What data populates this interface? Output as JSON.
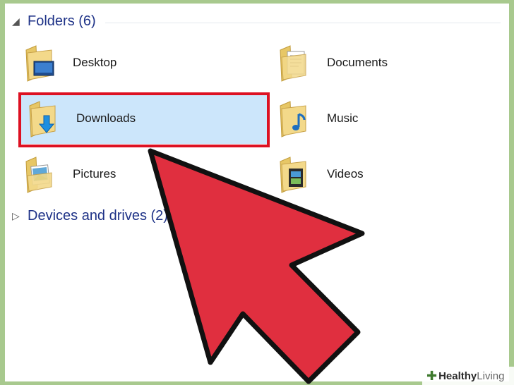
{
  "folders_group": {
    "label": "Folders (6)"
  },
  "folders": [
    {
      "label": "Desktop",
      "icon": "desktop-folder-icon"
    },
    {
      "label": "Documents",
      "icon": "documents-folder-icon"
    },
    {
      "label": "Downloads",
      "icon": "downloads-folder-icon",
      "selected": true
    },
    {
      "label": "Music",
      "icon": "music-folder-icon"
    },
    {
      "label": "Pictures",
      "icon": "pictures-folder-icon"
    },
    {
      "label": "Videos",
      "icon": "videos-folder-icon"
    }
  ],
  "devices_group": {
    "label": "Devices and drives (2)"
  },
  "watermark": {
    "bold": "Healthy",
    "light": "Living"
  },
  "colors": {
    "highlight_outline": "#dd1122",
    "cursor_fill": "#e02f3f",
    "selection_bg": "#cce6fb",
    "group_header": "#1e3287"
  }
}
